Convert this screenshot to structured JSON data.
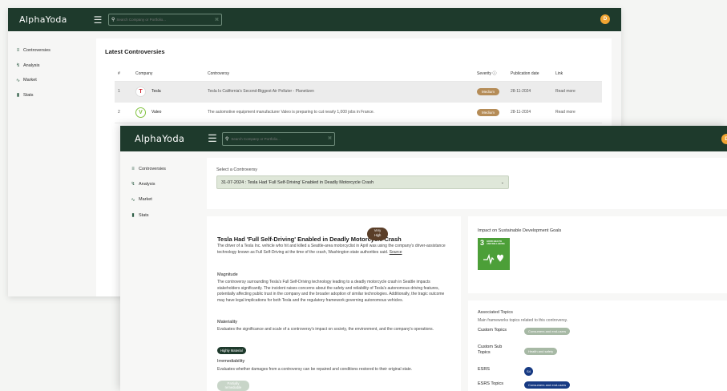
{
  "app": {
    "logo": "AlphaYoda",
    "avatar_initial": "D"
  },
  "search": {
    "placeholder": "Search Company or Portfolio...",
    "shortcut": "⌘"
  },
  "sidebar": {
    "items": [
      {
        "label": "Controversies",
        "icon": "list-icon"
      },
      {
        "label": "Analysis",
        "icon": "analysis-icon"
      },
      {
        "label": "Market",
        "icon": "market-icon"
      },
      {
        "label": "Stats",
        "icon": "stats-icon"
      }
    ]
  },
  "latest": {
    "title": "Latest Controversies",
    "columns": [
      "#",
      "Company",
      "Controversy",
      "Severity ⓘ",
      "Publication date",
      "Link"
    ],
    "rows": [
      {
        "num": "1",
        "company": "Tesla",
        "logo_letter": "T",
        "logo_color": "#cc1f2b",
        "controversy": "Tesla Is California's Second-Biggest Air Polluter - Planetizen",
        "severity": "Medium",
        "date": "28-11-2024",
        "link": "Read more"
      },
      {
        "num": "2",
        "company": "Valeo",
        "logo_letter": "V",
        "logo_color": "#82c341",
        "controversy": "The automotive equipment manufacturer Valeo is preparing to cut nearly 1,000 jobs in France.",
        "severity": "Medium",
        "date": "28-11-2024",
        "link": "Read more"
      }
    ]
  },
  "detail": {
    "select_label": "Select a Controversy",
    "select_value": "31-07-2024 : Tesla Had 'Full Self-Driving' Enabled in Deadly Motorcycle Crash",
    "title": "Tesla Had 'Full Self-Driving' Enabled in Deadly Motorcycle Crash",
    "severity_line1": "Very",
    "severity_line2": "High",
    "summary": "The driver of a Tesla Inc. vehicle who hit and killed a Seattle-area motorcyclist in April was using the company's driver-assistance technology known as Full Self-Driving at the time of the crash, Washington state authorities said.",
    "source": "Source",
    "magnitude_heading": "Magnitude",
    "magnitude_text": "The controversy surrounding Tesla's Full Self-Driving technology leading to a deadly motorcycle crash in Seattle impacts stakeholders significantly. The incident raises concerns about the safety and reliability of Tesla's autonomous driving features, potentially affecting public trust in the company and the broader adoption of similar technologies. Additionally, the tragic outcome may have legal implications for both Tesla and the regulatory framework governing autonomous vehicles.",
    "materiality_heading": "Materiality",
    "materiality_text": "Evaluates the significance and scale of a controversy's impact on society, the environment, and the company's operations.",
    "materiality_badge": "Highly Material",
    "irremediability_heading": "Irremediability",
    "irremediability_text": "Evaluates whether damages from a controversy can be repaired and conditions restored to their original state.",
    "irremediability_badge_1": "Partially",
    "irremediability_badge_2": "remediable"
  },
  "sdg": {
    "title": "Impact on Sustainable Development Goals",
    "goal_number": "3",
    "goal_text_1": "GOOD HEALTH",
    "goal_text_2": "AND WELL-BEING",
    "goal_color": "#4c9f38"
  },
  "topics": {
    "title": "Associated Topics",
    "subtitle": "Main frameworks topics related to this controversy.",
    "custom_topics_label": "Custom Topics",
    "custom_topics_value": "Consumers and end-users",
    "custom_sub_label_1": "Custom Sub",
    "custom_sub_label_2": "Topics",
    "custom_sub_value": "Health and safety",
    "esrs_label": "ESRS",
    "esrs_value": "S4",
    "esrs_topics_label": "ESRS Topics",
    "esrs_topics_value": "Consumers and end-users"
  }
}
